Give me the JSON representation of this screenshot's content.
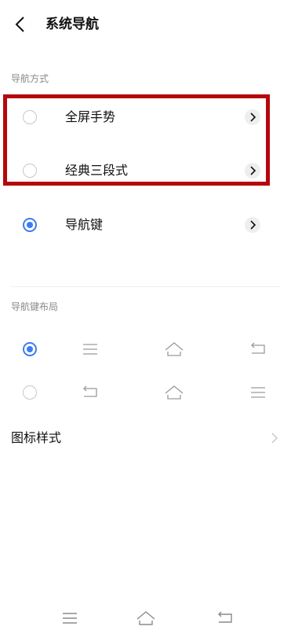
{
  "header": {
    "title": "系统导航"
  },
  "nav_mode": {
    "section_label": "导航方式",
    "options": [
      {
        "label": "全屏手势",
        "selected": false
      },
      {
        "label": "经典三段式",
        "selected": false
      },
      {
        "label": "导航键",
        "selected": true
      }
    ]
  },
  "layout": {
    "section_label": "导航键布局",
    "options": [
      {
        "selected": true,
        "keys": [
          "menu-icon",
          "home-icon",
          "back-icon"
        ]
      },
      {
        "selected": false,
        "keys": [
          "back-icon",
          "home-icon",
          "menu-icon"
        ]
      }
    ]
  },
  "icon_style": {
    "label": "图标样式"
  },
  "navbar": {
    "keys": [
      "menu-icon",
      "home-icon",
      "back-icon"
    ]
  },
  "colors": {
    "accent": "#3d7cf0",
    "highlight": "#b5070c"
  }
}
